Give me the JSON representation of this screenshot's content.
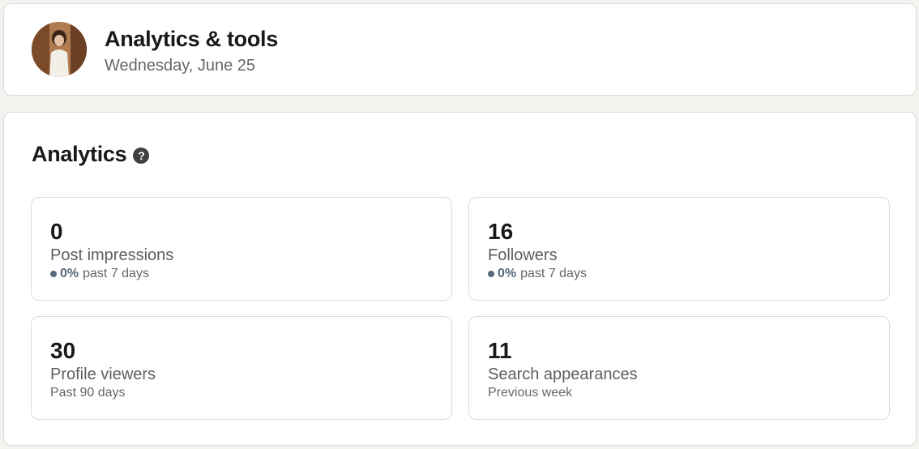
{
  "header": {
    "title": "Analytics & tools",
    "date": "Wednesday, June 25"
  },
  "analytics": {
    "title": "Analytics",
    "help_icon": "question-circle-icon",
    "metrics": [
      {
        "value": "0",
        "label": "Post impressions",
        "change_pct": "0%",
        "period": "past 7 days"
      },
      {
        "value": "16",
        "label": "Followers",
        "change_pct": "0%",
        "period": "past 7 days"
      },
      {
        "value": "30",
        "label": "Profile viewers",
        "period": "Past 90 days"
      },
      {
        "value": "11",
        "label": "Search appearances",
        "period": "Previous week"
      }
    ]
  },
  "colors": {
    "background": "#f3f2ef",
    "card": "#ffffff",
    "muted_text": "#666666",
    "trend_dot": "#56687a"
  }
}
